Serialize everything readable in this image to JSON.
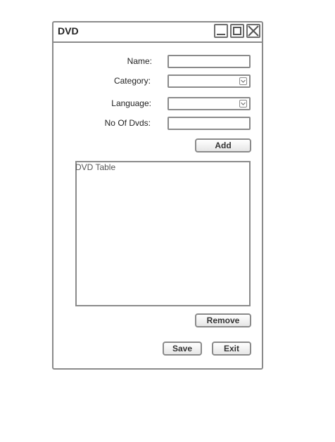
{
  "window": {
    "title": "DVD"
  },
  "form": {
    "name_label": "Name:",
    "name_value": "",
    "category_label": "Category:",
    "category_value": "",
    "language_label": "Language:",
    "language_value": "",
    "count_label": "No Of Dvds:",
    "count_value": ""
  },
  "buttons": {
    "add": "Add",
    "remove": "Remove",
    "save": "Save",
    "exit": "Exit"
  },
  "table": {
    "caption": "DVD Table"
  },
  "icons": {
    "minimize": "minimize-icon",
    "maximize": "maximize-icon",
    "close": "close-icon",
    "dropdown": "chevron-down-icon"
  }
}
